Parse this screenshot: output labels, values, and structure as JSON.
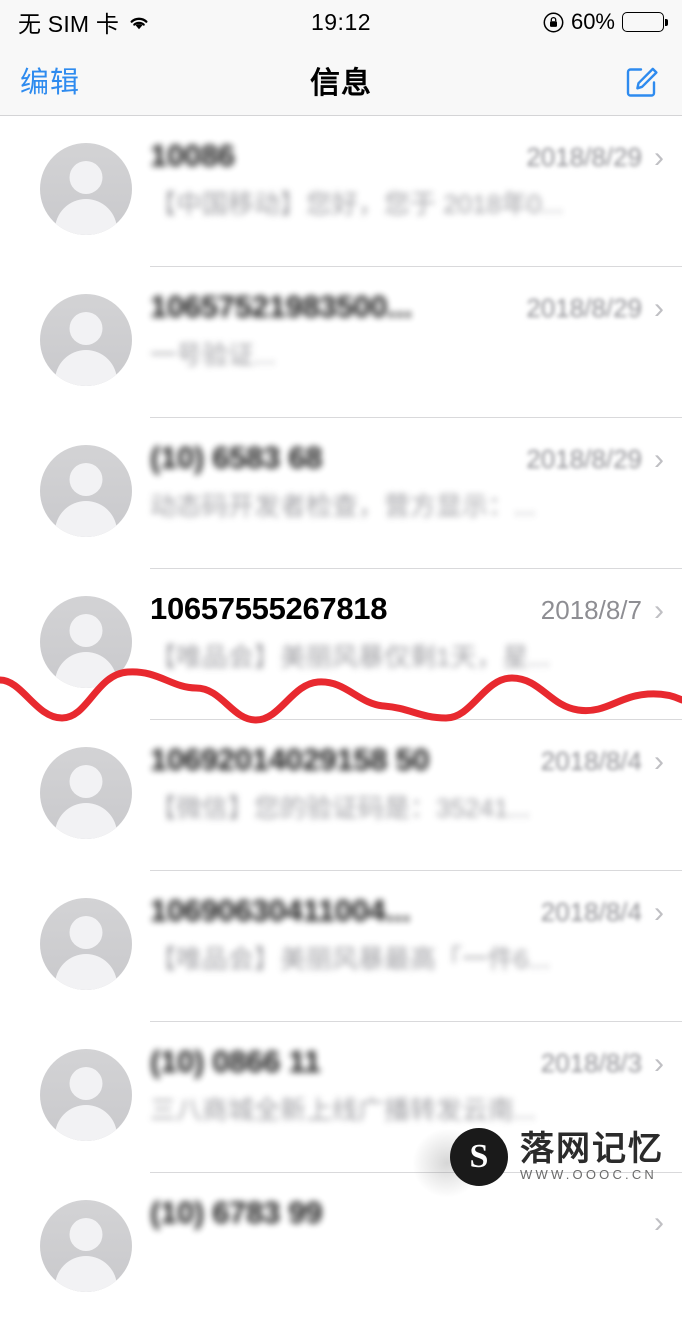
{
  "status_bar": {
    "carrier": "无 SIM 卡",
    "wifi_icon": "wifi-icon",
    "time": "19:12",
    "rotation_lock_icon": "rotation-lock-icon",
    "battery_percent": "60%",
    "battery_level": 60,
    "battery_icon": "battery-icon"
  },
  "nav_bar": {
    "edit_label": "编辑",
    "title": "信息",
    "compose_icon": "compose-icon"
  },
  "messages": [
    {
      "avatar_icon": "contact-avatar-icon",
      "sender": "10086",
      "date": "2018/8/29",
      "preview": "【中国移动】您好，您于 2018年0...",
      "blurred": true,
      "chevron": "›"
    },
    {
      "avatar_icon": "contact-avatar-icon",
      "sender": "10657521983500...",
      "date": "2018/8/29",
      "preview": "一号验证...",
      "blurred": true,
      "chevron": "›"
    },
    {
      "avatar_icon": "contact-avatar-icon",
      "sender": "(10) 6583 68",
      "date": "2018/8/29",
      "preview": "动态码开发者检查，营方显示：...",
      "blurred": true,
      "chevron": "›"
    },
    {
      "avatar_icon": "contact-avatar-icon",
      "sender": "10657555267818",
      "date": "2018/8/7",
      "preview": "【唯品会】美丽风暴仅剩1天，星...",
      "blurred": false,
      "chevron": "›"
    },
    {
      "avatar_icon": "contact-avatar-icon",
      "sender": "10692014029158 50",
      "date": "2018/8/4",
      "preview": "【微信】您的验证码是：35241...",
      "blurred": true,
      "chevron": "›"
    },
    {
      "avatar_icon": "contact-avatar-icon",
      "sender": "10690630411004...",
      "date": "2018/8/4",
      "preview": "【唯品会】美丽风暴最高「一件6...",
      "blurred": true,
      "chevron": "›"
    },
    {
      "avatar_icon": "contact-avatar-icon",
      "sender": "(10) 0866 11",
      "date": "2018/8/3",
      "preview": "三八商城全新上线广播转发云南...",
      "blurred": true,
      "chevron": "›"
    },
    {
      "avatar_icon": "contact-avatar-icon",
      "sender": "(10) 6783 99",
      "date": "",
      "preview": "",
      "blurred": true,
      "chevron": "›"
    }
  ],
  "overlay": {
    "waveform_color": "#e8292f",
    "waveform_name": "red-waveform-overlay"
  },
  "watermark": {
    "logo_letter": "S",
    "main_text": "落网记忆",
    "sub_text": "WWW.OOOC.CN"
  }
}
